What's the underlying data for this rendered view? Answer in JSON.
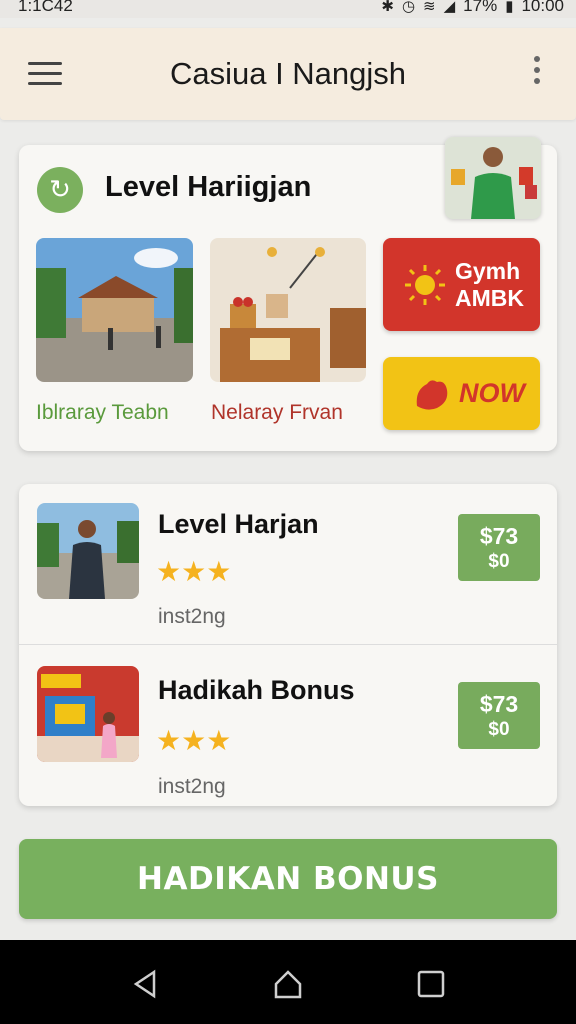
{
  "status_bar": {
    "time_left": "1:1C42",
    "battery": "17%",
    "time_right": "10:00",
    "icons": [
      "bluetooth-off-icon",
      "alarm-icon",
      "wifi-icon",
      "signal-icon",
      "battery-icon"
    ]
  },
  "app_bar": {
    "title": "Casiua I Nangjsh",
    "icons": [
      "menu-icon",
      "more-vert-icon"
    ]
  },
  "featured_card": {
    "title": "Level Hariigjan",
    "badge_icon": "phone-leaf-icon",
    "thumbnails": [
      {
        "caption": "Iblraray Teabn",
        "icon": "house-photo"
      },
      {
        "caption": "Nelaray Frvan",
        "icon": "shelf-photo"
      }
    ],
    "promo_buttons": [
      {
        "label_line1": "Gymh",
        "label_line2": "AMBK",
        "icon": "sun-icon",
        "color": "#d2352b"
      },
      {
        "label": "NOW",
        "icon": "hand-icon",
        "color": "#f2c315"
      }
    ]
  },
  "list": {
    "items": [
      {
        "title": "Level Harjan",
        "rating": 3,
        "subtitle": "inst2ng",
        "price_line1": "$73",
        "price_line2": "$0"
      },
      {
        "title": "Hadikah Bonus",
        "rating": 3,
        "subtitle": "inst2ng",
        "price_line1": "$73",
        "price_line2": "$0"
      }
    ]
  },
  "bonus_button": {
    "label": "HADIKAN BONUS",
    "color": "#78b05e"
  },
  "nav_bar": {
    "icons": [
      "back-icon",
      "home-icon",
      "recents-icon"
    ]
  },
  "colors": {
    "accent_green": "#78ab5d",
    "accent_red": "#d2352b",
    "accent_yellow": "#f2c315",
    "star": "#f5b21f"
  }
}
